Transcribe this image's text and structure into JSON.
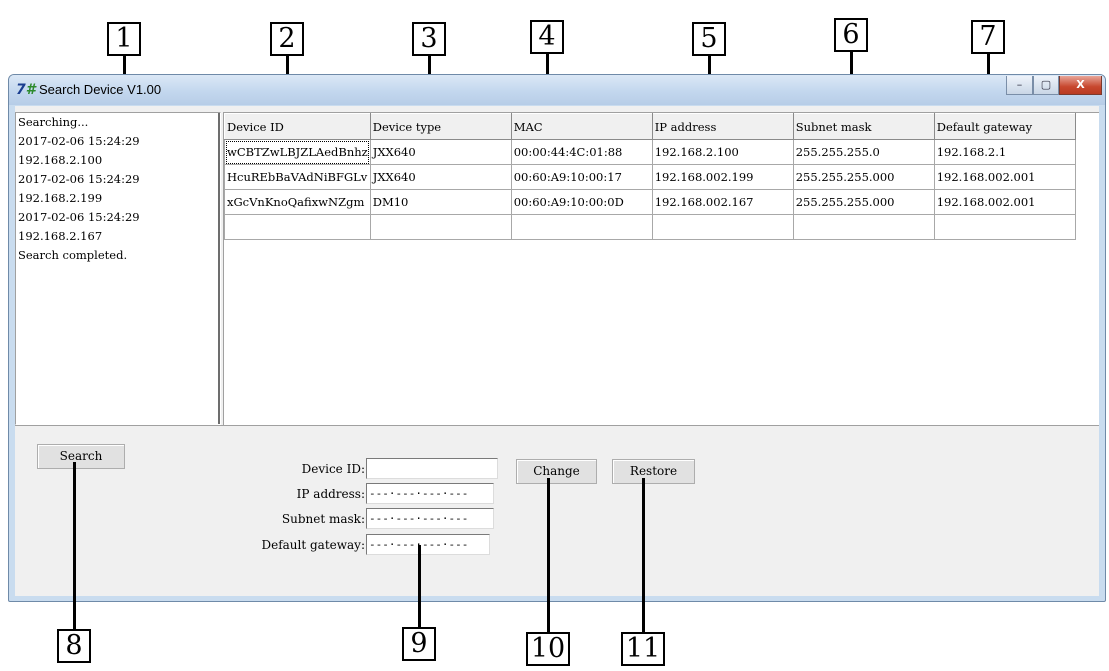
{
  "window": {
    "title": "Search Device V1.00",
    "controls": {
      "minimize": "–",
      "maximize": "▢",
      "close": "X"
    }
  },
  "callouts": [
    "1",
    "2",
    "3",
    "4",
    "5",
    "6",
    "7",
    "8",
    "9",
    "10",
    "11"
  ],
  "log": {
    "lines": [
      "Searching...",
      "2017-02-06 15:24:29",
      "192.168.2.100",
      "2017-02-06 15:24:29",
      "192.168.2.199",
      "2017-02-06 15:24:29",
      "192.168.2.167",
      "Search completed."
    ]
  },
  "table": {
    "columns": [
      "Device ID",
      "Device type",
      "MAC",
      "IP address",
      "Subnet mask",
      "Default gateway"
    ],
    "rows": [
      [
        "wCBTZwLBJZLAedBnhz",
        "JXX640",
        "00:00:44:4C:01:88",
        "192.168.2.100",
        "255.255.255.0",
        "192.168.2.1"
      ],
      [
        "HcuREbBaVAdNiBFGLv",
        "JXX640",
        "00:60:A9:10:00:17",
        "192.168.002.199",
        "255.255.255.000",
        "192.168.002.001"
      ],
      [
        "xGcVnKnoQafixwNZgm",
        "DM10",
        "00:60:A9:10:00:0D",
        "192.168.002.167",
        "255.255.255.000",
        "192.168.002.001"
      ],
      [
        "",
        "",
        "",
        "",
        "",
        ""
      ]
    ]
  },
  "buttons": {
    "search": "Search",
    "change": "Change",
    "restore": "Restore"
  },
  "form": {
    "device_id_label": "Device ID:",
    "ip_label": "IP address:",
    "subnet_label": "Subnet mask:",
    "gateway_label": "Default gateway:",
    "device_id_value": "",
    "ip_value": "---·---·---·---",
    "subnet_value": "---·---·---·---",
    "gateway_value": "---·---·---·---"
  }
}
